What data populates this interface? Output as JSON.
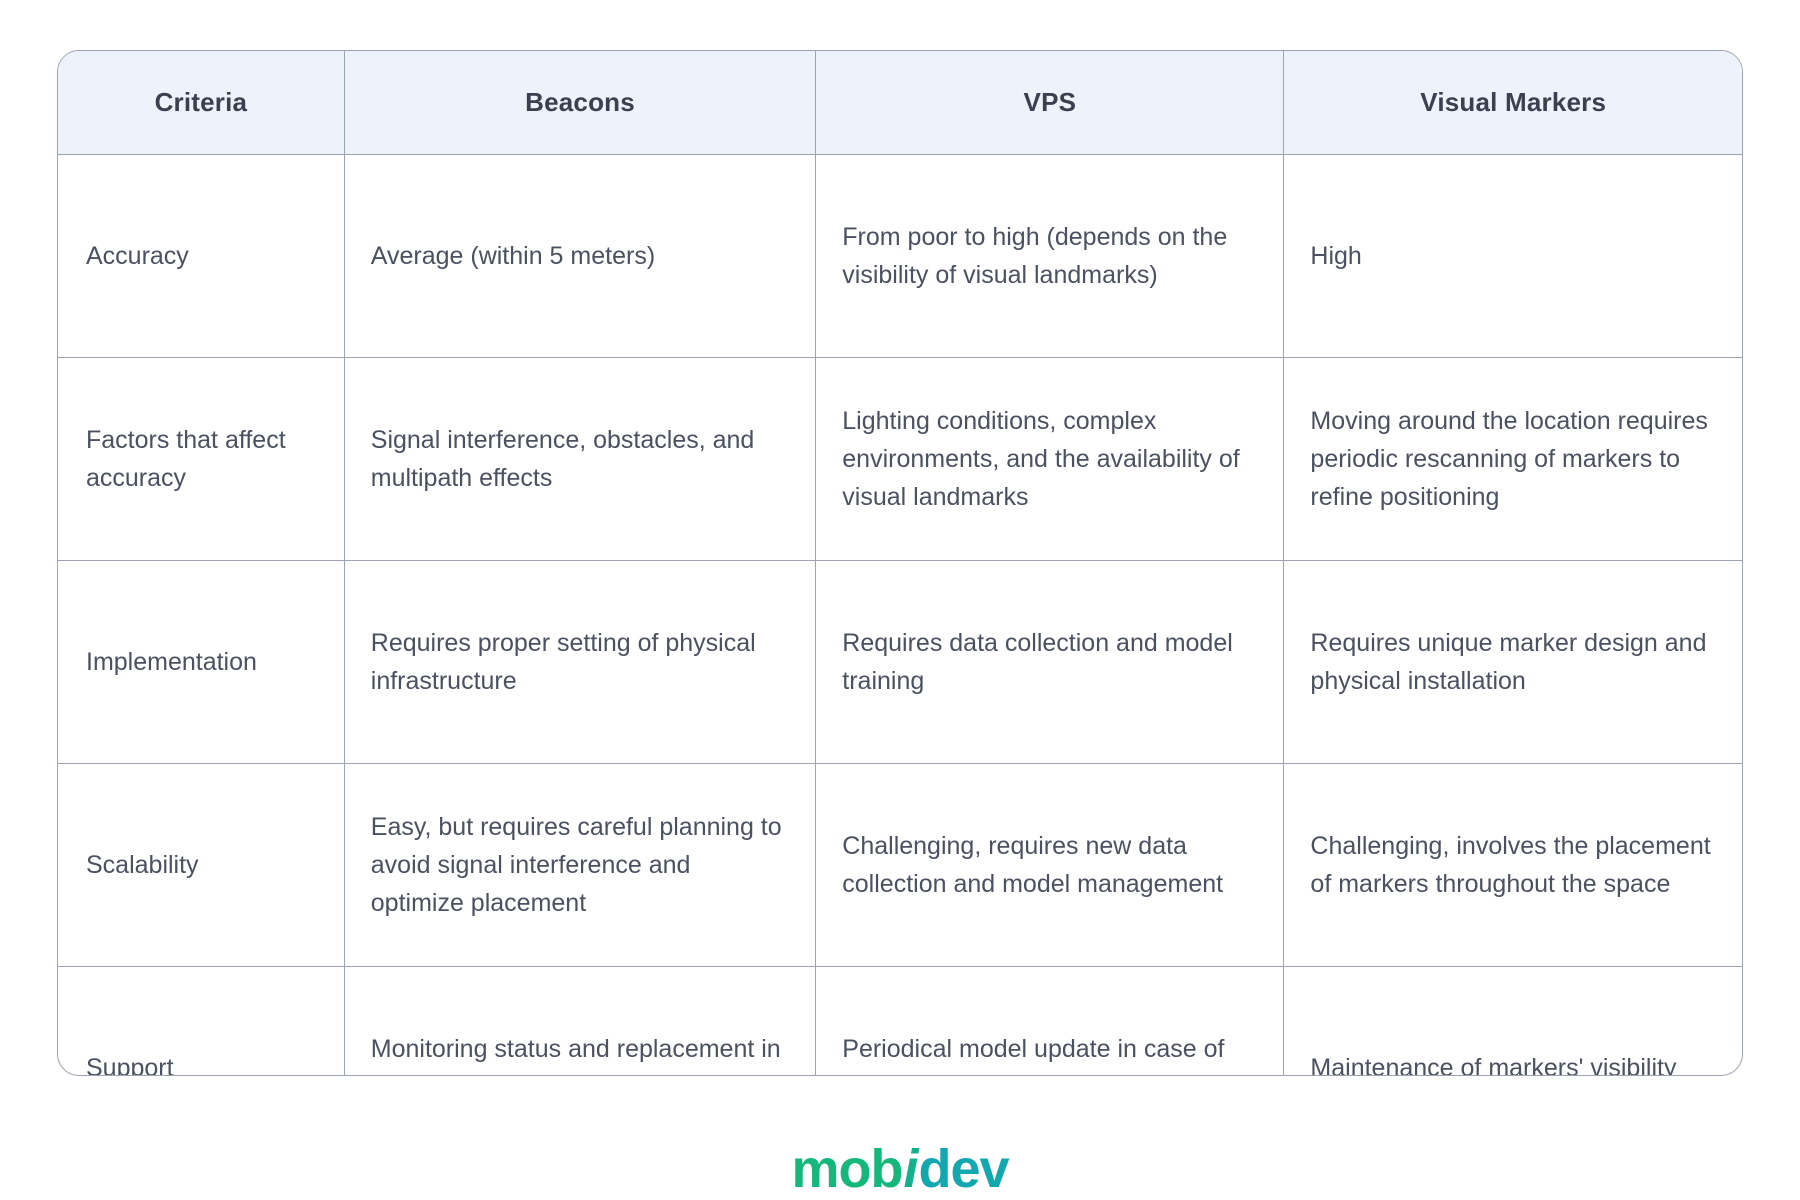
{
  "table": {
    "columns": [
      {
        "key": "criteria",
        "label": "Criteria"
      },
      {
        "key": "beacons",
        "label": "Beacons"
      },
      {
        "key": "vps",
        "label": "VPS"
      },
      {
        "key": "markers",
        "label": "Visual Markers"
      }
    ],
    "rows": [
      {
        "criteria": "Accuracy",
        "beacons": "Average (within 5 meters)",
        "vps": "From poor to high (depends on the visibility of visual landmarks)",
        "markers": "High"
      },
      {
        "criteria": "Factors that affect accuracy",
        "beacons": "Signal interference, obstacles, and multipath effects",
        "vps": "Lighting conditions, complex environments, and the availability of visual landmarks",
        "markers": "Moving around the location requires periodic rescanning of markers to refine positioning"
      },
      {
        "criteria": "Implementation",
        "beacons": "Requires proper setting of physical infrastructure",
        "vps": "Requires data collection and model training",
        "markers": "Requires unique marker design and physical installation"
      },
      {
        "criteria": "Scalability",
        "beacons": "Easy, but requires careful planning to avoid signal interference and optimize placement",
        "vps": "Challenging, requires new data collection and model management",
        "markers": "Challenging, involves the placement of markers throughout the space"
      },
      {
        "criteria": "Support",
        "beacons": "Monitoring status and replacement in case of failure",
        "vps": "Periodical model update in case of environment changes",
        "markers": "Maintenance of markers' visibility"
      }
    ]
  },
  "logo": {
    "part1": "mob",
    "part2": "i",
    "part3": "dev",
    "color_green": "#15b87a",
    "color_teal": "#13a7b0"
  },
  "colors": {
    "header_background": "#eef2fb",
    "border": "#9ba2b0",
    "header_text": "#3a4050",
    "body_text": "#4b5160",
    "page_background": "#ffffff"
  }
}
